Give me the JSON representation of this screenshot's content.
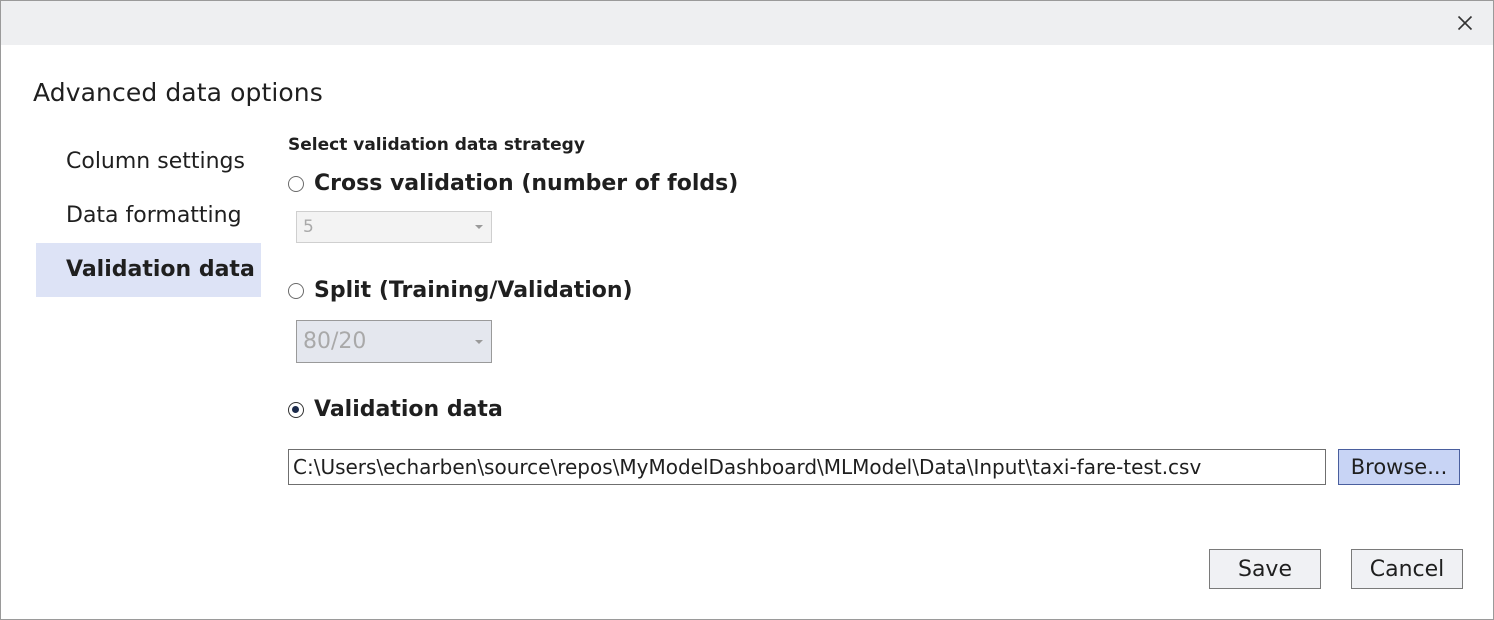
{
  "dialog": {
    "title": "Advanced data options",
    "close_icon": "close-icon"
  },
  "nav": {
    "items": [
      {
        "label": "Column settings",
        "active": false
      },
      {
        "label": "Data formatting",
        "active": false
      },
      {
        "label": "Validation data",
        "active": true
      }
    ]
  },
  "strategy": {
    "heading": "Select validation data strategy",
    "cross_validation": {
      "label": "Cross validation (number of folds)",
      "checked": false,
      "folds_value": "5"
    },
    "split": {
      "label": "Split (Training/Validation)",
      "checked": false,
      "ratio_value": "80/20"
    },
    "validation_data": {
      "label": "Validation data",
      "checked": true,
      "path": "C:\\Users\\echarben\\source\\repos\\MyModelDashboard\\MLModel\\Data\\Input\\taxi-fare-test.csv",
      "browse_label": "Browse..."
    }
  },
  "footer": {
    "save_label": "Save",
    "cancel_label": "Cancel"
  },
  "colors": {
    "active_nav_bg": "#dde3f6",
    "browse_bg": "#c8d4f5"
  }
}
